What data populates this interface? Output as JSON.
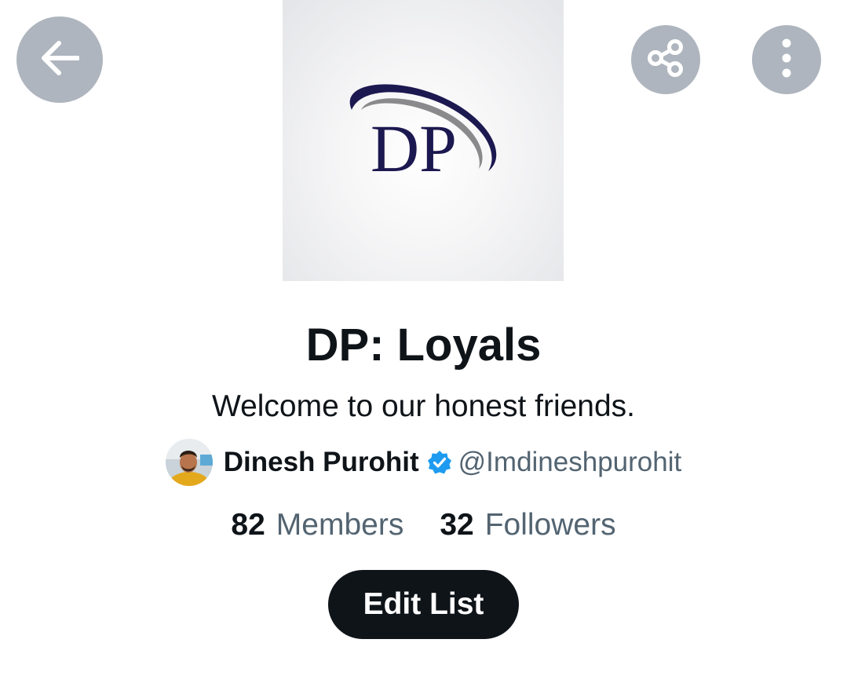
{
  "header": {
    "back_icon": "arrow-left-icon",
    "share_icon": "share-icon",
    "more_icon": "more-vertical-icon",
    "button_bg": "#aeb5be"
  },
  "banner": {
    "logo_text": "DP"
  },
  "list": {
    "title": "DP: Loyals",
    "description": "Welcome to our honest friends."
  },
  "owner": {
    "name": "Dinesh Purohit",
    "handle": "@Imdineshpurohit",
    "verified": true,
    "verified_color": "#1d9bf0"
  },
  "stats": {
    "members_count": "82",
    "members_label": "Members",
    "followers_count": "32",
    "followers_label": "Followers"
  },
  "actions": {
    "edit_label": "Edit List"
  },
  "colors": {
    "text_primary": "#0f1419",
    "text_secondary": "#536471",
    "logo_navy": "#1c1850",
    "logo_gray": "#8a8a8c"
  }
}
